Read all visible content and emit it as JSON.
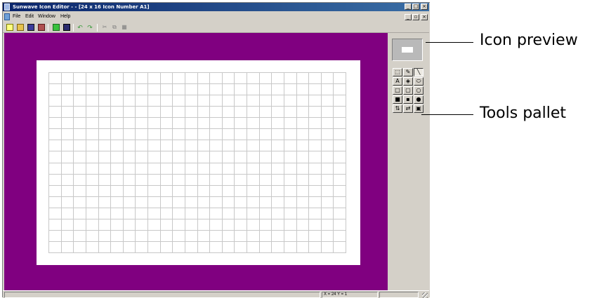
{
  "window": {
    "title": "Sunwave Icon Editor - - [24 x 16 Icon Number A1]",
    "controls": {
      "minimize": "_",
      "maximize": "□",
      "close": "×",
      "restore": "▫"
    }
  },
  "menu": {
    "items": [
      "File",
      "Edit",
      "Window",
      "Help"
    ]
  },
  "toolbar": {
    "undo_glyph": "↶",
    "redo_glyph": "↷",
    "cut_glyph": "✂",
    "copy_glyph": "⧉",
    "paste_glyph": "▦"
  },
  "canvas": {
    "grid_columns": 24,
    "grid_rows": 16,
    "background_color": "#800080",
    "grid_line_color": "#c8c8c8"
  },
  "tools": [
    {
      "name": "select",
      "glyph": "⬚"
    },
    {
      "name": "pencil",
      "glyph": "✎"
    },
    {
      "name": "line",
      "glyph": "╲"
    },
    {
      "name": "text",
      "glyph": "A"
    },
    {
      "name": "fill",
      "glyph": "◈"
    },
    {
      "name": "eraser",
      "glyph": "⬭"
    },
    {
      "name": "rectangle",
      "glyph": "□"
    },
    {
      "name": "rounded-rectangle",
      "glyph": "▢"
    },
    {
      "name": "ellipse",
      "glyph": "○"
    },
    {
      "name": "filled-rectangle",
      "glyph": "■"
    },
    {
      "name": "filled-rounded-rectangle",
      "glyph": "▪"
    },
    {
      "name": "filled-ellipse",
      "glyph": "●"
    },
    {
      "name": "flip",
      "glyph": "⇅"
    },
    {
      "name": "swap",
      "glyph": "⇄"
    },
    {
      "name": "color",
      "glyph": "▣"
    }
  ],
  "status": {
    "coords": "X = 24  Y = 1"
  },
  "annotations": {
    "icon_preview": "Icon preview",
    "tools_pallet": "Tools pallet"
  }
}
